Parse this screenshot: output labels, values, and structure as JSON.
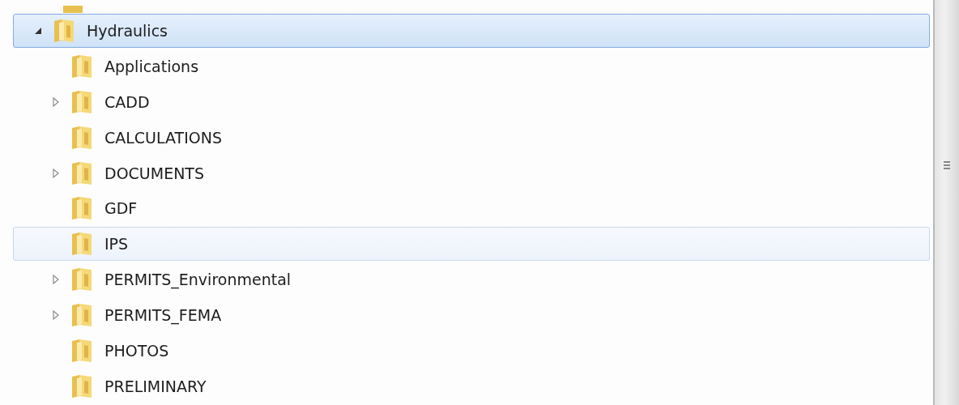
{
  "tree": [
    {
      "label": "Hydraulics",
      "expanded": true,
      "selected": true,
      "hovered": false,
      "children": [
        {
          "label": "Applications",
          "selected": false,
          "hovered": false
        },
        {
          "label": "CADD",
          "expanded": false,
          "selected": false,
          "hovered": false
        },
        {
          "label": "CALCULATIONS",
          "selected": false,
          "hovered": false
        },
        {
          "label": "DOCUMENTS",
          "expanded": false,
          "selected": false,
          "hovered": false
        },
        {
          "label": "GDF",
          "selected": false,
          "hovered": false
        },
        {
          "label": "IPS",
          "selected": false,
          "hovered": true
        },
        {
          "label": "PERMITS_Environmental",
          "expanded": false,
          "selected": false,
          "hovered": false
        },
        {
          "label": "PERMITS_FEMA",
          "expanded": false,
          "selected": false,
          "hovered": false
        },
        {
          "label": "PHOTOS",
          "selected": false,
          "hovered": false
        },
        {
          "label": "PRELIMINARY",
          "selected": false,
          "hovered": false
        }
      ]
    }
  ]
}
